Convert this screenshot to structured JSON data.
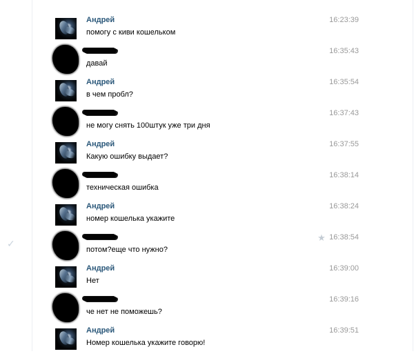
{
  "messages": [
    {
      "sender": "Андрей",
      "text": "помогу с киви кошельком",
      "time": "16:23:39",
      "avatar_icon": "andrey-avatar"
    },
    {
      "sender": "",
      "text": "давай",
      "time": "16:35:43",
      "avatar_icon": "blurred-avatar"
    },
    {
      "sender": "Андрей",
      "text": "в чем пробл?",
      "time": "16:35:54",
      "avatar_icon": "andrey-avatar"
    },
    {
      "sender": "",
      "text": "не могу снять 100штук уже три дня",
      "time": "16:37:43",
      "avatar_icon": "blurred-avatar"
    },
    {
      "sender": "Андрей",
      "text": "Какую ошибку выдает?",
      "time": "16:37:55",
      "avatar_icon": "andrey-avatar"
    },
    {
      "sender": "",
      "text": "техническая ошибка",
      "time": "16:38:14",
      "avatar_icon": "blurred-avatar"
    },
    {
      "sender": "Андрей",
      "text": "номер кошелька укажите",
      "time": "16:38:24",
      "avatar_icon": "andrey-avatar"
    },
    {
      "sender": "",
      "text": "потом?еще что нужно?",
      "time": "16:38:54",
      "avatar_icon": "blurred-avatar",
      "star_icon": "star-icon",
      "check_icon": "check-icon"
    },
    {
      "sender": "Андрей",
      "text": "Нет",
      "time": "16:39:00",
      "avatar_icon": "andrey-avatar"
    },
    {
      "sender": "",
      "text": "че нет не поможешь?",
      "time": "16:39:16",
      "avatar_icon": "blurred-avatar"
    },
    {
      "sender": "Андрей",
      "text": "Номер кошелька укажите говорю!",
      "time": "16:39:51",
      "avatar_icon": "andrey-avatar"
    }
  ],
  "colors": {
    "sender": "#2b587a",
    "time": "#999999",
    "text": "#000000",
    "background": "#ffffff",
    "star": "#c4ccd4",
    "check": "#c9d3dd"
  }
}
